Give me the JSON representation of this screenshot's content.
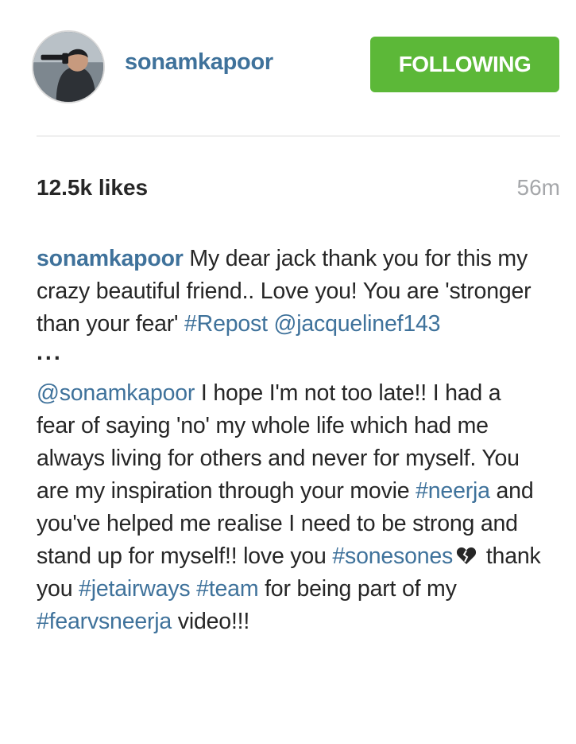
{
  "post": {
    "username": "sonamkapoor",
    "follow_label": "FOLLOWING",
    "likes": "12.5k likes",
    "time": "56m"
  },
  "caption": {
    "author": "sonamkapoor",
    "p1_text": " My dear jack thank you for this my crazy beautiful friend.. Love you! You are 'stronger than your fear' ",
    "p1_hashtag": "#Repost",
    "p1_space": " ",
    "p1_mention": "@jacquelinef143",
    "ellipsis": "...",
    "p2_mention": "@sonamkapoor",
    "p2_text_a": " I hope I'm not too late!! I had a fear of saying 'no' my whole life which had me always living for others and never for myself. You are my inspiration through your movie ",
    "p2_hashtag_neerja": "#neerja",
    "p2_text_b": " and you've helped me realise I need to be strong and stand up for myself!! love you ",
    "p2_hashtag_sonesones": "#sonesones",
    "p2_text_c": " thank you ",
    "p2_hashtag_jetairways": "#jetairways",
    "p2_space": " ",
    "p2_hashtag_team": "#team",
    "p2_text_d": " for being part of my ",
    "p2_hashtag_fearvsneerja": "#fearvsneerja",
    "p2_text_e": " video!!!"
  },
  "icons": {
    "heart": "broken-heart-icon"
  },
  "colors": {
    "username": "#3f729b",
    "follow_button": "#5cb838",
    "time": "#a5a7aa",
    "text": "#262626"
  }
}
